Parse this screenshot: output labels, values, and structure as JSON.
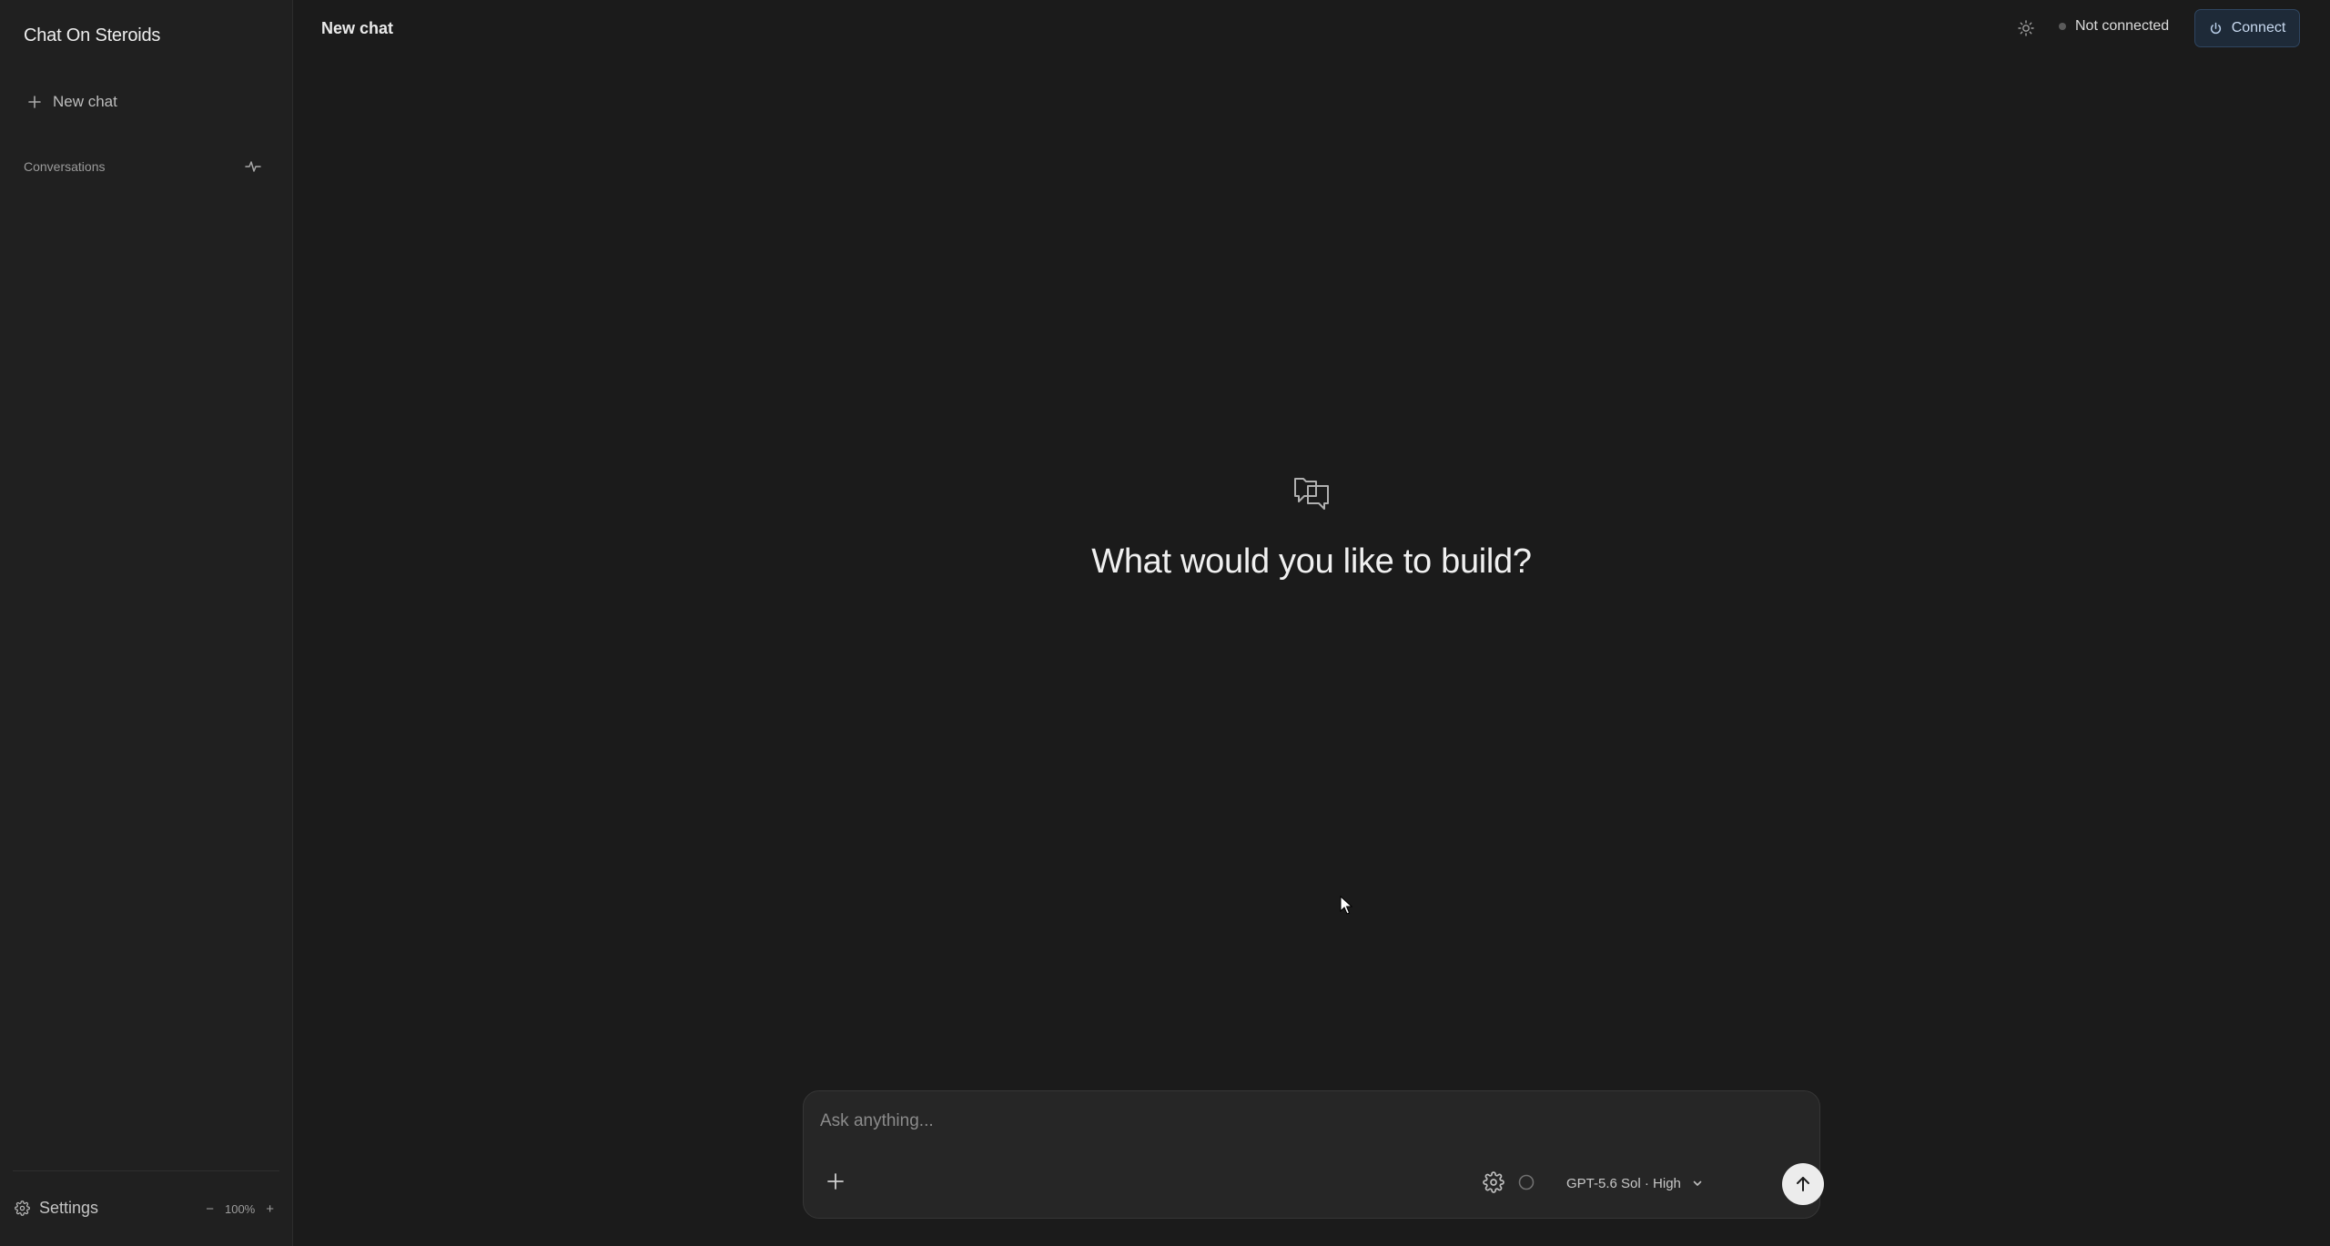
{
  "sidebar": {
    "brand": "Chat On Steroids",
    "new_chat_label": "New chat",
    "section_label": "Conversations",
    "settings_label": "Settings",
    "zoom_out": "−",
    "zoom_level": "100%",
    "zoom_in": "+"
  },
  "header": {
    "title": "New chat",
    "status": "Not connected",
    "connect_label": "Connect"
  },
  "empty_state": {
    "heading": "What would you like to build?"
  },
  "composer": {
    "placeholder": "Ask anything...",
    "model_label": "GPT-5.6 Sol · High"
  },
  "colors": {
    "background": "#1b1b1b",
    "sidebar": "#202020",
    "connect_button": "#1e2a38",
    "status_dot": "#5a5a5a"
  },
  "icons": [
    "plus-icon",
    "activity-icon",
    "gear-icon",
    "sun-icon",
    "power-icon",
    "chat-bubbles-icon",
    "settings-icon",
    "circle-icon",
    "chevron-down-icon",
    "arrow-up-icon"
  ]
}
